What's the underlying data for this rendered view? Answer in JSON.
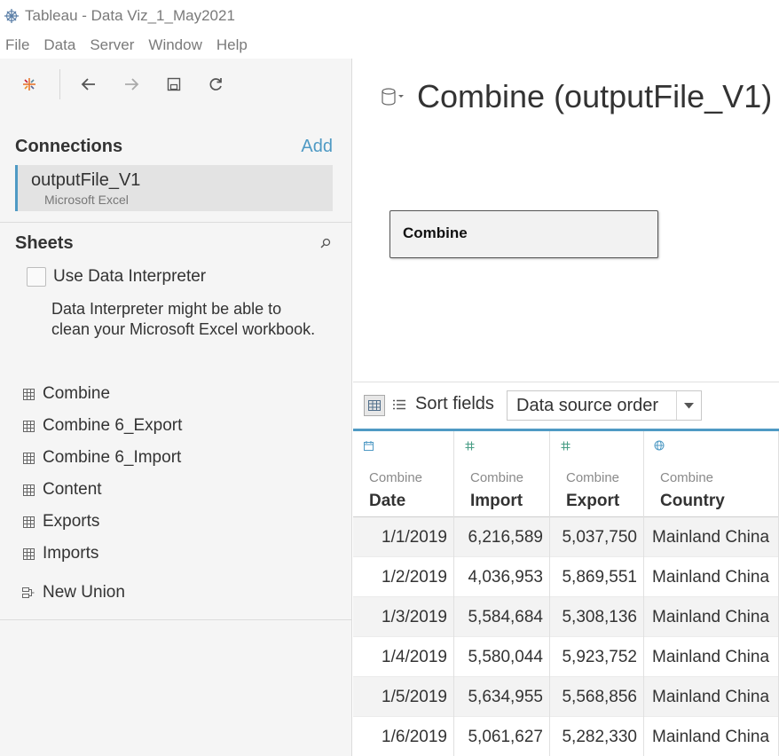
{
  "window": {
    "title": "Tableau - Data Viz_1_May2021"
  },
  "menu": [
    "File",
    "Data",
    "Server",
    "Window",
    "Help"
  ],
  "toolbar": {
    "logo_icon": "tableau-logo-icon",
    "back_icon": "arrow-left-icon",
    "forward_icon": "arrow-right-icon",
    "save_icon": "save-icon",
    "refresh_icon": "refresh-icon"
  },
  "connections": {
    "title": "Connections",
    "add_label": "Add",
    "items": [
      {
        "name": "outputFile_V1",
        "type": "Microsoft Excel"
      }
    ]
  },
  "sheets": {
    "title": "Sheets",
    "use_interpreter_label": "Use Data Interpreter",
    "interpreter_description": "Data Interpreter might be able to clean your Microsoft Excel workbook.",
    "items": [
      "Combine",
      "Combine 6_Export",
      "Combine 6_Import",
      "Content",
      "Exports",
      "Imports"
    ],
    "new_union_label": "New Union"
  },
  "datasource": {
    "title": "Combine (outputFile_V1)",
    "canvas_table": "Combine"
  },
  "grid_toolbar": {
    "sort_label": "Sort fields",
    "sort_value": "Data source order"
  },
  "grid": {
    "columns": [
      {
        "source": "Combine",
        "name": "Date",
        "type_icon": "calendar-icon",
        "align": "num"
      },
      {
        "source": "Combine",
        "name": "Import",
        "type_icon": "number-icon",
        "align": "num"
      },
      {
        "source": "Combine",
        "name": "Export",
        "type_icon": "number-icon",
        "align": "num"
      },
      {
        "source": "Combine",
        "name": "Country",
        "type_icon": "globe-icon",
        "align": "txt"
      }
    ],
    "rows": [
      [
        "1/1/2019",
        "6,216,589",
        "5,037,750",
        "Mainland China"
      ],
      [
        "1/2/2019",
        "4,036,953",
        "5,869,551",
        "Mainland China"
      ],
      [
        "1/3/2019",
        "5,584,684",
        "5,308,136",
        "Mainland China"
      ],
      [
        "1/4/2019",
        "5,580,044",
        "5,923,752",
        "Mainland China"
      ],
      [
        "1/5/2019",
        "5,634,955",
        "5,568,856",
        "Mainland China"
      ],
      [
        "1/6/2019",
        "5,061,627",
        "5,282,330",
        "Mainland China"
      ]
    ]
  },
  "colors": {
    "accent": "#4f9ac4",
    "number_icon": "#4a9e86",
    "calendar_icon": "#4f9ac4",
    "globe_icon": "#4f9ac4"
  }
}
